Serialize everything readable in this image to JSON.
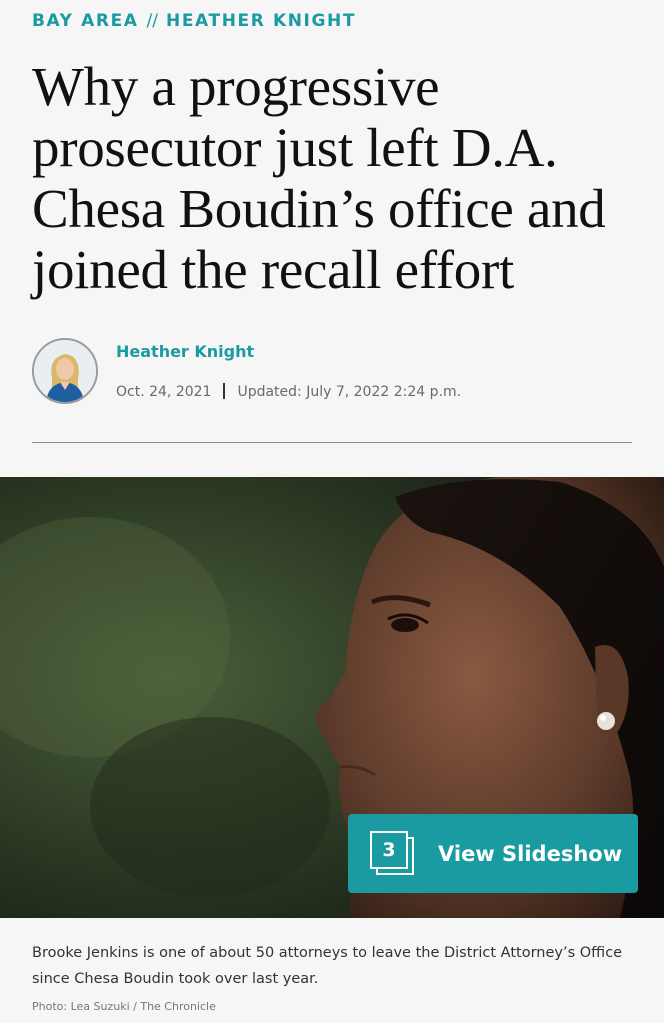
{
  "section": {
    "category": "BAY AREA",
    "separator": "//",
    "column": "HEATHER KNIGHT"
  },
  "headline": "Why a progressive prosecutor just left D.A. Chesa Boudin’s office and joined the recall effort",
  "byline": {
    "author": "Heather Knight",
    "published": "Oct. 24, 2021",
    "updated": "Updated: July 7, 2022 2:24 p.m."
  },
  "photo": {
    "slideshow_count": "3",
    "slideshow_label": "View Slideshow",
    "caption": "Brooke Jenkins is one of about 50 attorneys to leave the District Attorney’s Office since Chesa Boudin took over last year.",
    "credit": "Photo: Lea Suzuki / The Chronicle"
  },
  "colors": {
    "accent": "#1a9aa1",
    "background": "#f6f6f6",
    "headline": "#111111"
  },
  "icons": {
    "slideshow": "stacked-photos-icon"
  }
}
